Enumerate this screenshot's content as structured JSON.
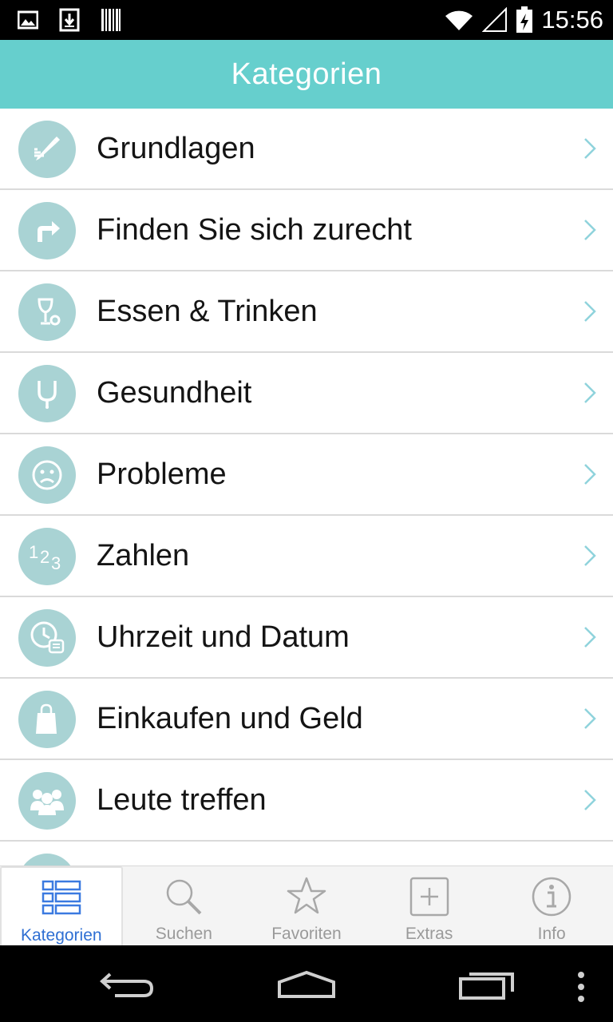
{
  "status_bar": {
    "time": "15:56",
    "left_icons": [
      "image-icon",
      "download-icon",
      "barcode-icon"
    ],
    "right_icons": [
      "wifi-icon",
      "signal-icon",
      "battery-icon"
    ]
  },
  "app_bar": {
    "title": "Kategorien"
  },
  "categories": [
    {
      "label": "Grundlagen",
      "icon": "pencil-icon"
    },
    {
      "label": "Finden Sie sich zurecht",
      "icon": "turn-right-arrow-icon"
    },
    {
      "label": "Essen & Trinken",
      "icon": "wine-glass-icon"
    },
    {
      "label": "Gesundheit",
      "icon": "stethoscope-icon"
    },
    {
      "label": "Probleme",
      "icon": "sad-face-icon"
    },
    {
      "label": "Zahlen",
      "icon": "numbers-icon"
    },
    {
      "label": "Uhrzeit und Datum",
      "icon": "clock-calendar-icon"
    },
    {
      "label": "Einkaufen und Geld",
      "icon": "shopping-bag-icon"
    },
    {
      "label": "Leute treffen",
      "icon": "people-icon"
    }
  ],
  "tabs": [
    {
      "label": "Kategorien",
      "icon": "list-grid-icon",
      "active": true
    },
    {
      "label": "Suchen",
      "icon": "search-icon",
      "active": false
    },
    {
      "label": "Favoriten",
      "icon": "star-icon",
      "active": false
    },
    {
      "label": "Extras",
      "icon": "plus-box-icon",
      "active": false
    },
    {
      "label": "Info",
      "icon": "info-icon",
      "active": false
    }
  ],
  "nav_bar": {
    "buttons": [
      "back-icon",
      "home-icon",
      "recents-icon",
      "overflow-menu-icon"
    ]
  },
  "colors": {
    "accent": "#66cfcd",
    "icon_circle": "#a9d3d4",
    "chevron": "#8fd3dc",
    "tab_active": "#2f6fd3"
  }
}
